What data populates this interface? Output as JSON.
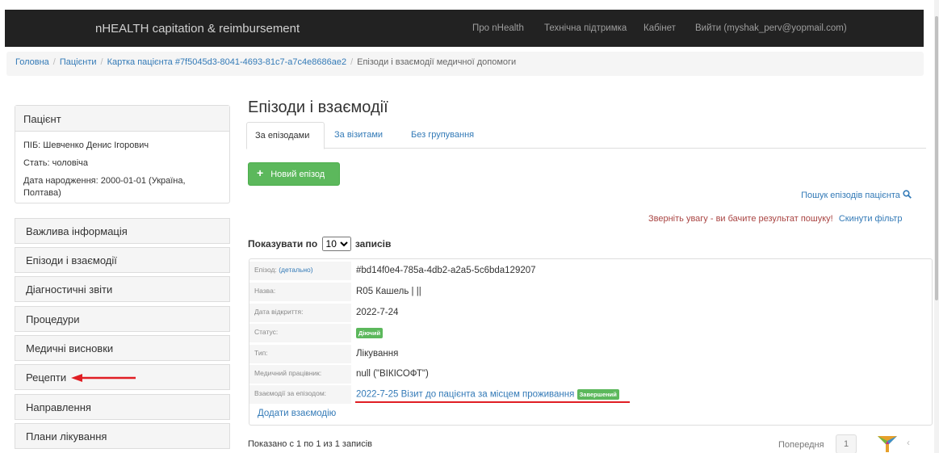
{
  "navbar": {
    "brand": "nHEALTH capitation & reimbursement",
    "links": [
      "Про nHealth",
      "Технічна підтримка",
      "Кабінет",
      "Вийти (myshak_perv@yopmail.com)"
    ]
  },
  "breadcrumb": {
    "items": [
      "Головна",
      "Пацієнти",
      "Картка пацієнта #7f5045d3-8041-4693-81c7-a7c4e8686ae2"
    ],
    "active": "Епізоди і взаємодії медичної допомоги"
  },
  "patient": {
    "heading": "Пацієнт",
    "name": "ПІБ: Шевченко Денис Ігорович",
    "gender": "Стать: чоловіча",
    "birth_line1": "Дата народження: 2000-01-01 (Україна,",
    "birth_line2": "Полтава)"
  },
  "sidebar": {
    "items": [
      "Важлива інформація",
      "Епізоди і взаємодії",
      "Діагностичні звіти",
      "Процедури",
      "Медичні висновки",
      "Рецепти",
      "Направлення",
      "Плани лікування"
    ]
  },
  "main": {
    "title": "Епізоди і взаємодії",
    "tabs": [
      "За епізодами",
      "За візитами",
      "Без групування"
    ],
    "new_episode_label": "Новий епізод",
    "search_label": "Пошук епізодів пацієнта",
    "notice_warn": "Зверніть увагу - ви бачите результат пошуку!",
    "notice_reset": "Скинути фільтр",
    "show_prefix": "Показувати по",
    "page_size": "10",
    "show_suffix": "записів"
  },
  "episode": {
    "id_label": "Епізод:",
    "id_link": "(детально)",
    "id_value": "#bd14f0e4-785a-4db2-a2a5-5c6bda129207",
    "name_label": "Назва:",
    "name_value": "R05 Кашель | ||",
    "open_date_label": "Дата відкриття:",
    "open_date_value": "2022-7-24",
    "status_label": "Статус:",
    "status_value": "Діючий",
    "type_label": "Тип:",
    "type_value": "Лікування",
    "worker_label": "Медичний працівник:",
    "worker_value": "null (\"ВІКІСОФТ\")",
    "interactions_label": "Взаємодії за епізодом:",
    "interaction_link": "2022-7-25 Візит до пацієнта за місцем проживання",
    "interaction_status": "Завершений",
    "add_interaction": "Додати взаємодію"
  },
  "footer": {
    "info": "Показано с 1 по 1 из 1 записів",
    "prev": "Попередня",
    "page": "1",
    "next": "‹"
  },
  "colors": {
    "navbar": "#222222",
    "link": "#337ab7",
    "success": "#5cb85c",
    "warning_text": "#a94442",
    "annotation_red": "#e01e24"
  }
}
